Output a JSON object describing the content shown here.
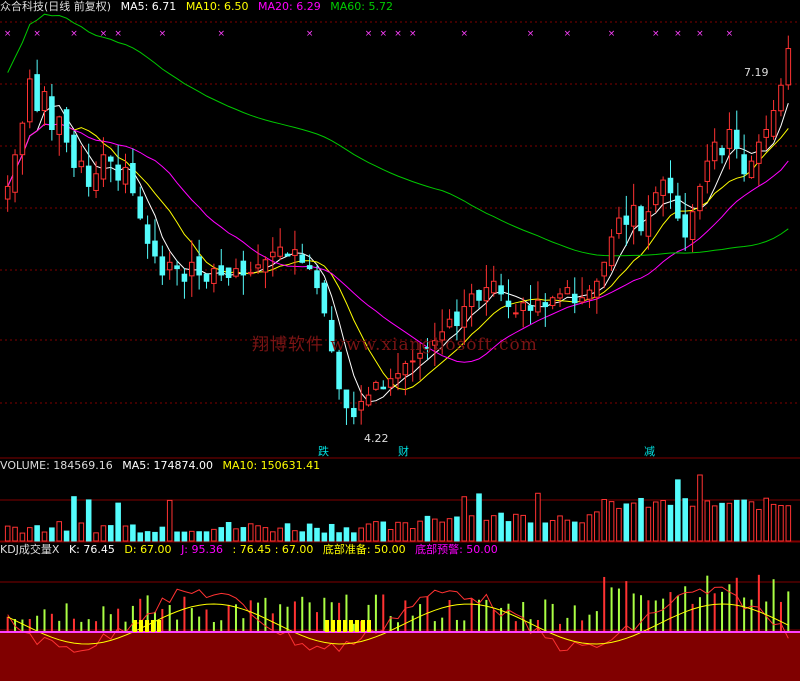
{
  "header": {
    "title": "众合科技(日线 前复权)",
    "ma5": "MA5: 6.71",
    "ma10": "MA10: 6.50",
    "ma20": "MA20: 6.29",
    "ma60": "MA60: 5.72"
  },
  "volume_header": {
    "title": "VOLUME: 184569.16",
    "ma5": "MA5: 174874.00",
    "ma10": "MA10: 150631.41"
  },
  "kdj_header": {
    "title": "KDJ成交量X",
    "k": "K: 76.45",
    "d": "D: 67.00",
    "j": "J: 95.36",
    "extra": ": 76.45 : 67.00",
    "bottom_ready": "底部准备: 50.00",
    "bottom_warn": "底部预警: 50.00"
  },
  "watermark": "翔博软件 www.xiangbosoft.com",
  "annotations": {
    "high": "7.19",
    "low": "4.22",
    "sig1": "跌",
    "sig2": "财",
    "sig3": "减"
  },
  "colors": {
    "up": "#ff3232",
    "down": "#54fcfc",
    "ma5": "#ffffff",
    "ma10": "#ffff00",
    "ma20": "#ff00ff",
    "ma60": "#00c800",
    "grid": "#800000"
  },
  "chart_data": {
    "type": "candlestick",
    "title": "众合科技(日线 前复权)",
    "price_range": [
      4.0,
      7.4
    ],
    "price_annotations": {
      "high": 7.19,
      "low": 4.22
    },
    "ma_values": {
      "MA5": 6.71,
      "MA10": 6.5,
      "MA20": 6.29,
      "MA60": 5.72
    },
    "close": [
      6.1,
      6.35,
      6.6,
      6.95,
      6.7,
      6.85,
      6.55,
      6.65,
      6.45,
      6.25,
      6.3,
      6.1,
      6.2,
      6.35,
      6.3,
      6.15,
      6.25,
      6.05,
      5.85,
      5.65,
      5.55,
      5.4,
      5.5,
      5.45,
      5.35,
      5.5,
      5.4,
      5.35,
      5.45,
      5.4,
      5.38,
      5.45,
      5.4,
      5.42,
      5.48,
      5.52,
      5.58,
      5.62,
      5.55,
      5.6,
      5.5,
      5.45,
      5.3,
      5.1,
      4.8,
      4.5,
      4.35,
      4.28,
      4.4,
      4.45,
      4.55,
      4.5,
      4.58,
      4.62,
      4.7,
      4.72,
      4.78,
      4.82,
      4.88,
      4.95,
      5.05,
      5.0,
      5.15,
      5.25,
      5.2,
      5.3,
      5.35,
      5.25,
      5.15,
      5.1,
      5.18,
      5.12,
      5.2,
      5.15,
      5.22,
      5.25,
      5.3,
      5.18,
      5.22,
      5.28,
      5.35,
      5.5,
      5.7,
      5.85,
      5.8,
      5.95,
      5.75,
      5.9,
      6.05,
      6.15,
      6.05,
      5.85,
      5.7,
      5.9,
      6.1,
      6.3,
      6.45,
      6.35,
      6.55,
      6.4,
      6.2,
      6.3,
      6.45,
      6.55,
      6.7,
      6.9,
      7.19
    ],
    "volume": {
      "value": 184569.16,
      "ma5": 174874.0,
      "ma10": 150631.41
    },
    "kdj": {
      "K": 76.45,
      "D": 67.0,
      "J": 95.36,
      "bottom_ready": 50.0,
      "bottom_warn": 50.0
    }
  }
}
